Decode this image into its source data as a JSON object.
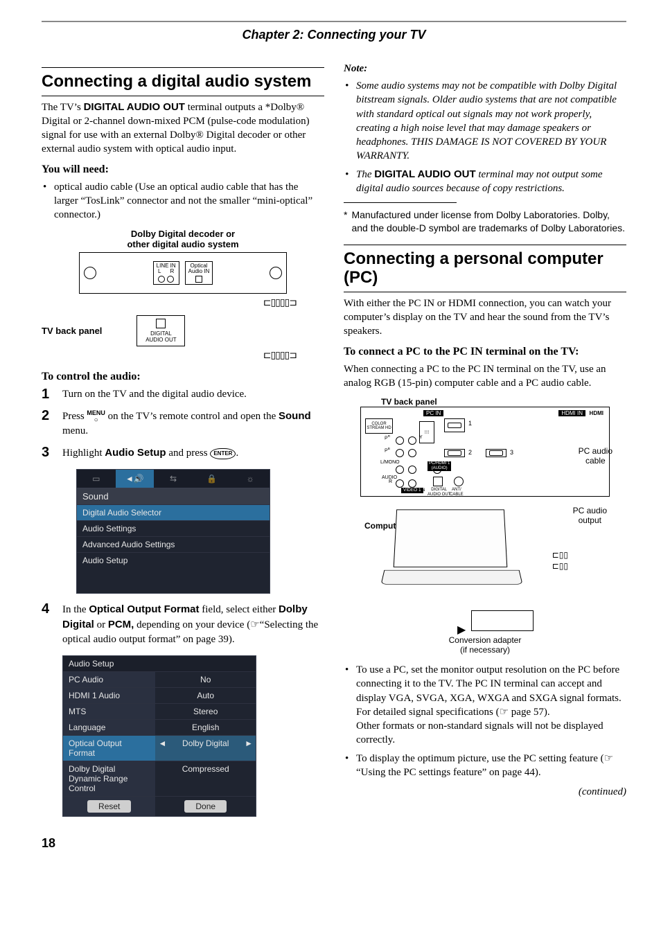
{
  "chapter": "Chapter 2: Connecting your TV",
  "page_number": "18",
  "left": {
    "section_title": "Connecting a digital audio system",
    "intro_pre": "The TV’s ",
    "intro_term": "DIGITAL AUDIO OUT",
    "intro_post": " terminal outputs a *Dolby® Digital or 2-channel down-mixed PCM (pulse-code modulation) signal for use with an external Dolby® Digital decoder or other external audio system with optical audio input.",
    "need_head": "You will need:",
    "need_item": "optical audio cable (Use an optical audio cable that has the larger “TosLink” connector and not the smaller “mini-optical” connector.)",
    "diagram": {
      "decoder_label": "Dolby Digital decoder or\nother digital audio system",
      "line_in": "LINE IN",
      "lr": "L      R",
      "opt_in": "Optical\nAudio IN",
      "tv_label": "TV back panel",
      "digital_out": "DIGITAL\nAUDIO OUT"
    },
    "control_head": "To control the audio:",
    "step1": "Turn on the TV and the digital audio device.",
    "step2_pre": "Press ",
    "step2_menu": "MENU",
    "step2_mid": " on the TV’s remote control and open the ",
    "step2_sound": "Sound",
    "step2_post": " menu.",
    "step3_pre": "Highlight ",
    "step3_as": "Audio Setup",
    "step3_mid": " and press ",
    "step3_enter": "ENTER",
    "step3_post": ".",
    "sound_menu": {
      "title": "Sound",
      "items": [
        "Digital Audio Selector",
        "Audio Settings",
        "Advanced Audio Settings",
        "Audio Setup"
      ]
    },
    "step4_pre": "In the ",
    "step4_f_oof": "Optical Output Format",
    "step4_mid1": " field, select either ",
    "step4_dd": "Dolby Digital",
    "step4_mid2": " or ",
    "step4_pcm": "PCM,",
    "step4_post": " depending on your device (☞“Selecting the optical audio output format” on page 39).",
    "audio_setup": {
      "title": "Audio Setup",
      "rows": [
        {
          "l": "PC Audio",
          "r": "No"
        },
        {
          "l": "HDMI 1 Audio",
          "r": "Auto"
        },
        {
          "l": "MTS",
          "r": "Stereo"
        },
        {
          "l": "Language",
          "r": "English"
        },
        {
          "l": "Optical Output Format",
          "r": "Dolby Digital"
        },
        {
          "l": "Dolby Digital\nDynamic Range Control",
          "r": "Compressed"
        }
      ],
      "reset": "Reset",
      "done": "Done"
    }
  },
  "right": {
    "note_head": "Note:",
    "note1_a": "Some audio systems may not be compatible with Dolby Digital bitstream signals. Older audio systems that are not compatible with standard optical out signals may not work properly, creating a high noise level that may damage speakers or headphones. THIS DAMAGE IS NOT COVERED BY YOUR WARRANTY.",
    "note2_pre": "The ",
    "note2_term": "DIGITAL AUDIO OUT",
    "note2_post": " terminal may not output some digital audio sources because of copy restrictions.",
    "footnote": "Manufactured under license from Dolby Laboratories. Dolby, and the double-D symbol are trademarks of Dolby Laboratories.",
    "section_title": "Connecting a personal computer (PC)",
    "intro": "With either the PC IN or HDMI connection, you can watch your computer’s display on the TV and hear the sound from the TV’s speakers.",
    "connect_head": "To connect a PC to the PC IN terminal on the TV:",
    "connect_body": "When connecting a PC to the PC IN terminal on the TV, use an analog RGB (15-pin) computer cable and a PC audio cable.",
    "pcdiag": {
      "tv_label": "TV back panel",
      "pc_in": "PC IN",
      "hdmi_in": "HDMI IN",
      "hdmi": "HDMI",
      "colorstream": "COLOR\nSTREAM HD",
      "pc_hdmi_audio": "PC/HDMI 1\n(AUDIO)",
      "digital_audio": "DIGITAL\nAUDIO OUT",
      "ant": "ANT/\nCABLE",
      "video1": "VIDEO 1",
      "computer": "Computer",
      "pc_audio_cable": "PC audio\ncable",
      "pc_audio_output": "PC audio\noutput",
      "conv": "Conversion adapter\n(if necessary)"
    },
    "bul1": "To use a PC, set the monitor output resolution on the PC before connecting it to the TV. The PC IN terminal can accept and display VGA, SVGA, XGA, WXGA and SXGA signal formats. For detailed signal specifications (☞ page 57).",
    "bul1_extra": "Other formats or non-standard signals will not be displayed correctly.",
    "bul2": "To display the optimum picture, use the PC setting feature (☞ “Using the PC settings feature” on page 44).",
    "continued": "(continued)"
  }
}
